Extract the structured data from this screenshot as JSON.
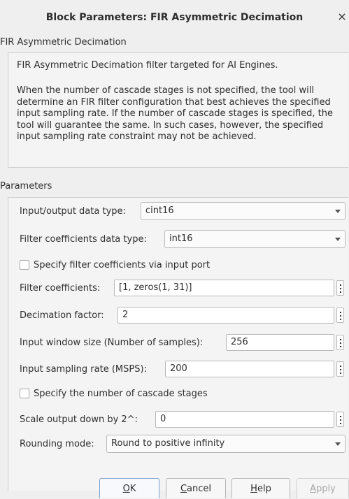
{
  "window": {
    "title": "Block Parameters: FIR Asymmetric Decimation",
    "close_glyph": "×"
  },
  "block_section": {
    "label": "FIR Asymmetric Decimation",
    "description_1": "FIR Asymmetric Decimation filter targeted for AI Engines.",
    "description_2": "When the number of cascade stages is not specified, the tool will determine an FIR filter configuration that best achieves the specified input sampling rate. If the number of cascade stages is specified, the tool will guarantee the same. In such cases, however, the specified input sampling rate constraint may not be achieved."
  },
  "parameters": {
    "label": "Parameters",
    "io_type": {
      "label": "Input/output data type:",
      "value": "cint16"
    },
    "coeff_type": {
      "label": "Filter coefficients data type:",
      "value": "int16"
    },
    "coeff_port": {
      "label": "Specify filter coefficients via input port",
      "checked": false
    },
    "coefficients": {
      "label": "Filter coefficients:",
      "value": "[1, zeros(1, 31)]"
    },
    "decimation": {
      "label": "Decimation factor:",
      "value": "2"
    },
    "window_size": {
      "label": "Input window size (Number of samples):",
      "value": "256"
    },
    "sampling_rate": {
      "label": "Input sampling rate (MSPS):",
      "value": "200"
    },
    "cascade": {
      "label": "Specify the number of cascade stages",
      "checked": false
    },
    "scale": {
      "label": "Scale output down by 2^:",
      "value": "0"
    },
    "rounding": {
      "label": "Rounding mode:",
      "value": "Round to positive infinity"
    }
  },
  "buttons": {
    "ok_mnemonic": "O",
    "ok_rest": "K",
    "cancel_mnemonic": "C",
    "cancel_rest": "ancel",
    "help_mnemonic": "H",
    "help_rest": "elp",
    "apply_mnemonic": "A",
    "apply_rest": "pply"
  },
  "icons": {
    "close": "close-icon",
    "dropdown": "chevron-down-icon",
    "more": "kebab-menu-icon"
  }
}
